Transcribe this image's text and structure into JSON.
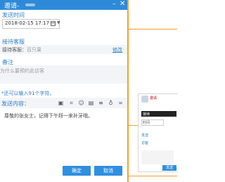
{
  "dialog": {
    "title": "邀请-",
    "section_send_time": "发送时间",
    "datetime_value": "2018-02-15 17:17",
    "section_contact": "接待客服",
    "contact_label": "接待客服：",
    "contact_name": "百只果",
    "modify_link": "修改",
    "section_note": "备注",
    "note_placeholder": "为什么要预约此访客",
    "char_hint": "*还可以输入91个字符。",
    "content_label": "发送内容：",
    "message_text": "尊敬的张女士，记得下午拜一来补牙哦。",
    "confirm_label": "确定",
    "cancel_label": "取消",
    "toolbar_icons": [
      "image-icon",
      "crop-icon",
      "smiley-icon",
      "document-icon",
      "list-icon",
      "microphone-icon",
      "link-icon"
    ]
  },
  "background_chat": {
    "send_button": "发送",
    "snippets": [
      "邀请",
      "接待",
      "时间",
      "发送",
      "访客"
    ]
  },
  "colors": {
    "accent": "#2e8ad8",
    "frame": "#f2a12b"
  }
}
